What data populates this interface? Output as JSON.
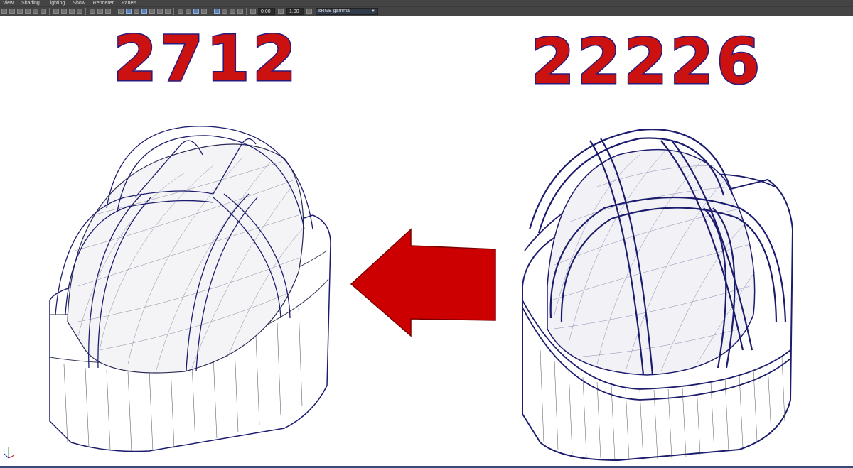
{
  "menu": [
    "View",
    "Shading",
    "Lighting",
    "Show",
    "Renderer",
    "Panels"
  ],
  "toolbar": {
    "exposure": "0.00",
    "gamma": "1.00",
    "color_space": "sRGB gamma"
  },
  "viewport": {
    "low_poly_count": "2712",
    "high_poly_count": "22226",
    "accent_color": "#cc1111",
    "wire_color": "#1c1c6e",
    "arrow_icon": "arrow-left-icon"
  }
}
